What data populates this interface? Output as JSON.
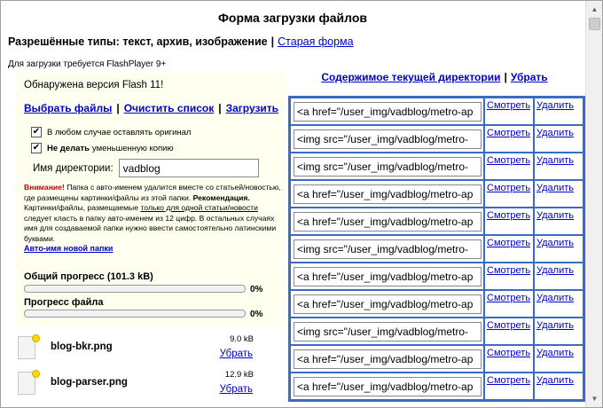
{
  "header": {
    "title": "Форма загрузки файлов",
    "allowed_types": "Разрешённые типы: текст, архив, изображение",
    "separator": "|",
    "old_form_link": "Старая форма",
    "flash_required": "Для загрузки требуется FlashPlayer 9+"
  },
  "uploader": {
    "flash_detected": "Обнаружена версия Flash 11!",
    "select_files": "Выбрать файлы",
    "clear_list": "Очистить список",
    "upload": "Загрузить",
    "keep_original": "В любом случае оставлять оригинал",
    "no_thumb_bold": "Не делать",
    "no_thumb_rest": "уменьшенную копию",
    "dir_label": "Имя директории:",
    "dir_value": "vadblog",
    "warning_title": "Внимание!",
    "warning_text": "Папка с авто-именем удалится вместе со статьей/новостью, где размещены картинки/файлы из этой папки.",
    "recommend_title": "Рекомендация.",
    "recommend_text_1": "Картинки/файлы, размещаемые",
    "recommend_underline": "только для одной статьи/новости",
    "recommend_text_2": "следует класть в папку авто-именем из 12 цифр. В остальных случаях имя для создаваемой папки нужно ввести самостоятельно латинскими буквами.",
    "auto_name_link": "Авто-имя новой папки",
    "total_progress_label": "Общий прогресс (101.3 kB)",
    "total_progress": 0,
    "total_progress_text": "0%",
    "file_progress_label": "Прогресс файла",
    "file_progress": 0,
    "file_progress_text": "0%"
  },
  "files": [
    {
      "name": "blog-bkr.png",
      "size": "9.0 kB",
      "remove": "Убрать"
    },
    {
      "name": "blog-parser.png",
      "size": "12.9 kB",
      "remove": "Убрать"
    }
  ],
  "directory": {
    "contents_link": "Содержимое текущей директории",
    "remove_link": "Убрать",
    "rows": [
      {
        "code": "<a href=\"/user_img/vadblog/metro-ap",
        "view": "Смотреть",
        "delete": "Удалить"
      },
      {
        "code": "<img src=\"/user_img/vadblog/metro-",
        "view": "Смотреть",
        "delete": "Удалить"
      },
      {
        "code": "<img src=\"/user_img/vadblog/metro-",
        "view": "Смотреть",
        "delete": "Удалить"
      },
      {
        "code": "<a href=\"/user_img/vadblog/metro-ap",
        "view": "Смотреть",
        "delete": "Удалить"
      },
      {
        "code": "<a href=\"/user_img/vadblog/metro-ap",
        "view": "Смотреть",
        "delete": "Удалить"
      },
      {
        "code": "<img src=\"/user_img/vadblog/metro-",
        "view": "Смотреть",
        "delete": "Удалить"
      },
      {
        "code": "<a href=\"/user_img/vadblog/metro-ap",
        "view": "Смотреть",
        "delete": "Удалить"
      },
      {
        "code": "<a href=\"/user_img/vadblog/metro-ap",
        "view": "Смотреть",
        "delete": "Удалить"
      },
      {
        "code": "<img src=\"/user_img/vadblog/metro-",
        "view": "Смотреть",
        "delete": "Удалить"
      },
      {
        "code": "<a href=\"/user_img/vadblog/metro-ap",
        "view": "Смотреть",
        "delete": "Удалить"
      },
      {
        "code": "<a href=\"/user_img/vadblog/metro-ap",
        "view": "Смотреть",
        "delete": "Удалить"
      }
    ]
  },
  "colors": {
    "link": "#0000cc",
    "table_border": "#3a6ac4",
    "panel_bg": "#fffff0",
    "warning": "#cc0000"
  }
}
